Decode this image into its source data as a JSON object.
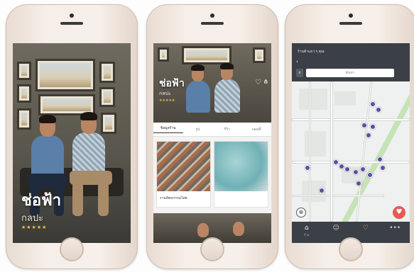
{
  "phones": {
    "phone1": {
      "title": "ช่อฟ้า",
      "subtitle": "กลปะ",
      "rating": "★★★★★"
    },
    "phone2": {
      "title": "ช่อฟ้า",
      "subtitle": "กลปะ",
      "rating": "★★★★★",
      "tabs": [
        "ข้อมูลร้าน",
        "รูป",
        "รีวิว",
        "แผนที่"
      ],
      "cards": [
        {
          "caption": "งานหัตถกรรมไทย"
        },
        {
          "caption": ""
        }
      ]
    },
    "phone3": {
      "header_title": "ร้านค้าแถว ๆ คุณ",
      "search_placeholder": "ค้นหา",
      "pin_count": 16,
      "tab_active_label": "ร้าน",
      "tab_icons": [
        "store-icon",
        "profile-icon",
        "heart-icon",
        "more-icon"
      ]
    }
  },
  "colors": {
    "map_pin": "#5a4ea3",
    "fav_button": "#e65a57",
    "header_bar": "#3b3f46"
  }
}
